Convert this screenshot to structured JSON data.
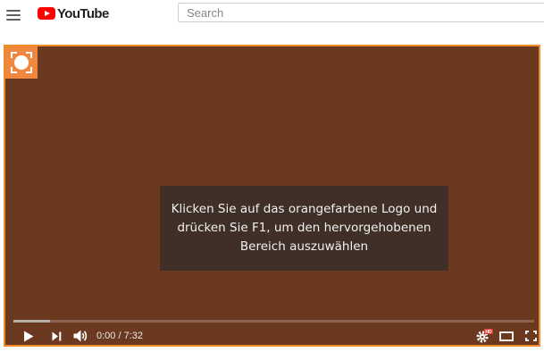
{
  "header": {
    "logo_text": "YouTube",
    "search_placeholder": "Search"
  },
  "player": {
    "message": "Klicken Sie auf das orangefarbene Logo und drücken Sie F1, um den hervorgehobenen Bereich auszuwählen",
    "current_time": "0:00",
    "duration": "7:32",
    "time_separator": " / ",
    "progress_fraction": 0.07,
    "hd_badge": "HD"
  },
  "colors": {
    "player_background": "#6b3920",
    "highlight_border": "#f28c28",
    "orange_logo": "#f0873e",
    "message_background": "#3f2f27",
    "youtube_red": "#ff0000"
  },
  "icons": [
    "menu-icon",
    "youtube-logo-icon",
    "orange-select-logo",
    "play-icon",
    "next-icon",
    "volume-icon",
    "settings-icon",
    "theater-mode-icon",
    "fullscreen-icon"
  ]
}
